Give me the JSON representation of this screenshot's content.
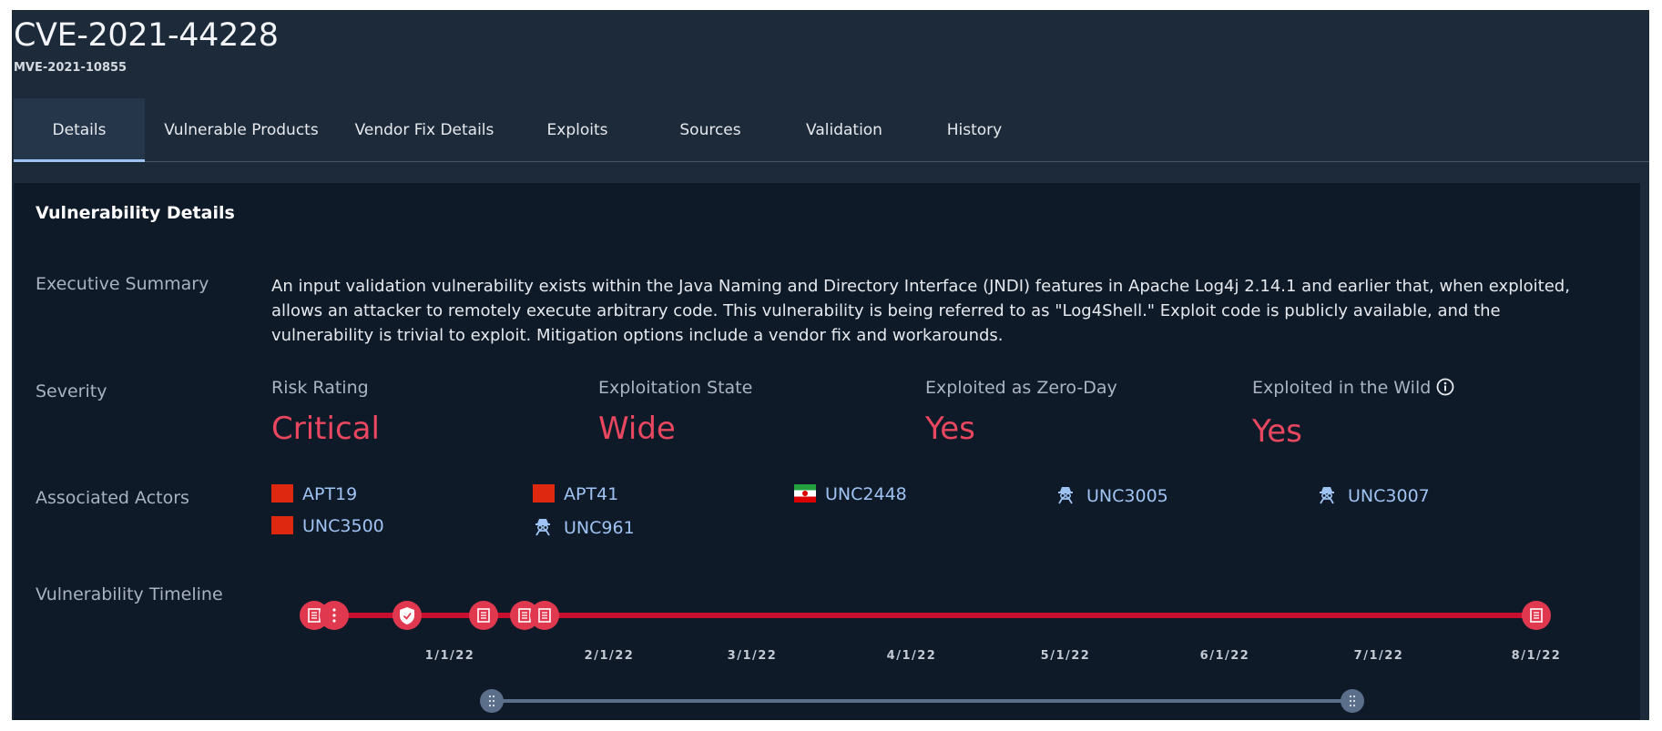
{
  "header": {
    "title": "CVE-2021-44228",
    "subtitle": "MVE-2021-10855"
  },
  "tabs": [
    {
      "label": "Details",
      "active": true
    },
    {
      "label": "Vulnerable Products"
    },
    {
      "label": "Vendor Fix Details"
    },
    {
      "label": "Exploits"
    },
    {
      "label": "Sources"
    },
    {
      "label": "Validation"
    },
    {
      "label": "History"
    }
  ],
  "details": {
    "section_title": "Vulnerability Details",
    "executive_summary_label": "Executive Summary",
    "executive_summary": "An input validation vulnerability exists within the Java Naming and Directory Interface (JNDI) features in Apache Log4j 2.14.1 and earlier that, when exploited, allows an attacker to remotely execute arbitrary code. This vulnerability is being referred to as \"Log4Shell.\" Exploit code is publicly available, and the vulnerability is trivial to exploit. Mitigation options include a vendor fix and workarounds.",
    "severity_label": "Severity",
    "severity": [
      {
        "label": "Risk Rating",
        "value": "Critical"
      },
      {
        "label": "Exploitation State",
        "value": "Wide"
      },
      {
        "label": "Exploited as Zero-Day",
        "value": "Yes"
      },
      {
        "label": "Exploited in the Wild",
        "value": "Yes",
        "info_icon": "info-icon"
      }
    ],
    "actors_label": "Associated Actors",
    "actors": [
      {
        "name": "APT19",
        "icon": "china-flag-icon"
      },
      {
        "name": "APT41",
        "icon": "china-flag-icon"
      },
      {
        "name": "UNC2448",
        "icon": "iran-flag-icon"
      },
      {
        "name": "UNC3005",
        "icon": "spy-icon"
      },
      {
        "name": "UNC3007",
        "icon": "spy-icon"
      },
      {
        "name": "UNC3500",
        "icon": "china-flag-icon"
      },
      {
        "name": "UNC961",
        "icon": "spy-icon"
      }
    ],
    "timeline_label": "Vulnerability Timeline",
    "timeline": {
      "ticks": [
        "1/1/22",
        "2/1/22",
        "3/1/22",
        "4/1/22",
        "5/1/22",
        "6/1/22",
        "7/1/22",
        "8/1/22"
      ],
      "line_color": "#c8102e",
      "marker_color": "#e0394f",
      "events": [
        {
          "icon": "report-icon"
        },
        {
          "icon": "more-icon"
        },
        {
          "icon": "shield-icon"
        },
        {
          "icon": "report-icon"
        },
        {
          "icon": "report-icon"
        },
        {
          "icon": "report-icon"
        },
        {
          "icon": "report-icon"
        }
      ],
      "range_slider": {
        "handles": 2
      }
    }
  },
  "colors": {
    "background": "#1d2a3a",
    "panel": "#0f1a29",
    "accent_link": "#9fc3f2",
    "severity": "#e8475f"
  }
}
